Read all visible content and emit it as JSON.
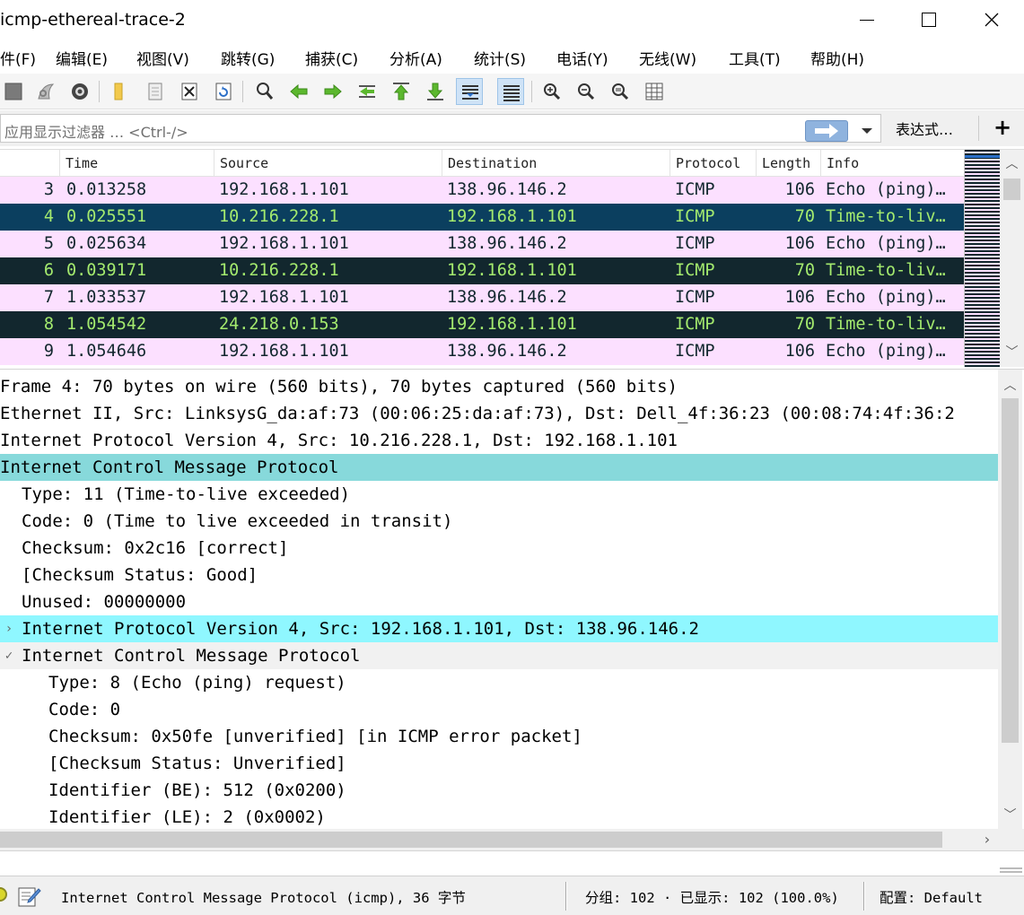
{
  "window": {
    "title": "icmp-ethereal-trace-2"
  },
  "menu": [
    {
      "label": "件(F)"
    },
    {
      "label": "编辑(E)"
    },
    {
      "label": "视图(V)"
    },
    {
      "label": "跳转(G)"
    },
    {
      "label": "捕获(C)"
    },
    {
      "label": "分析(A)"
    },
    {
      "label": "统计(S)"
    },
    {
      "label": "电话(Y)"
    },
    {
      "label": "无线(W)"
    },
    {
      "label": "工具(T)"
    },
    {
      "label": "帮助(H)"
    }
  ],
  "filter": {
    "placeholder": "应用显示过滤器 … <Ctrl-/>",
    "expression_label": "表达式…",
    "plus_label": "+"
  },
  "packet_list": {
    "columns": [
      "Time",
      "Source",
      "Destination",
      "Protocol",
      "Length",
      "Info"
    ],
    "rows": [
      {
        "no": "3",
        "time": "0.013258",
        "source": "192.168.1.101",
        "destination": "138.96.146.2",
        "protocol": "ICMP",
        "length": "106",
        "info": "Echo (ping)…",
        "style": "echo"
      },
      {
        "no": "4",
        "time": "0.025551",
        "source": "10.216.228.1",
        "destination": "192.168.1.101",
        "protocol": "ICMP",
        "length": "70",
        "info": "Time-to-liv…",
        "style": "selected"
      },
      {
        "no": "5",
        "time": "0.025634",
        "source": "192.168.1.101",
        "destination": "138.96.146.2",
        "protocol": "ICMP",
        "length": "106",
        "info": "Echo (ping)…",
        "style": "echo"
      },
      {
        "no": "6",
        "time": "0.039171",
        "source": "10.216.228.1",
        "destination": "192.168.1.101",
        "protocol": "ICMP",
        "length": "70",
        "info": "Time-to-liv…",
        "style": "ttl"
      },
      {
        "no": "7",
        "time": "1.033537",
        "source": "192.168.1.101",
        "destination": "138.96.146.2",
        "protocol": "ICMP",
        "length": "106",
        "info": "Echo (ping)…",
        "style": "echo"
      },
      {
        "no": "8",
        "time": "1.054542",
        "source": "24.218.0.153",
        "destination": "192.168.1.101",
        "protocol": "ICMP",
        "length": "70",
        "info": "Time-to-liv…",
        "style": "ttl"
      },
      {
        "no": "9",
        "time": "1.054646",
        "source": "192.168.1.101",
        "destination": "138.96.146.2",
        "protocol": "ICMP",
        "length": "106",
        "info": "Echo (ping)…",
        "style": "echo"
      }
    ]
  },
  "details": {
    "rows": [
      {
        "text": "Frame 4: 70 bytes on wire (560 bits), 70 bytes captured (560 bits)",
        "indent": 0,
        "style": ""
      },
      {
        "text": "Ethernet II, Src: LinksysG_da:af:73 (00:06:25:da:af:73), Dst: Dell_4f:36:23 (00:08:74:4f:36:2",
        "indent": 0,
        "style": ""
      },
      {
        "text": "Internet Protocol Version 4, Src: 10.216.228.1, Dst: 192.168.1.101",
        "indent": 0,
        "style": ""
      },
      {
        "text": "Internet Control Message Protocol",
        "indent": 0,
        "style": "sel"
      },
      {
        "text": "Type: 11 (Time-to-live exceeded)",
        "indent": 1,
        "style": ""
      },
      {
        "text": "Code: 0 (Time to live exceeded in transit)",
        "indent": 1,
        "style": ""
      },
      {
        "text": "Checksum: 0x2c16 [correct]",
        "indent": 1,
        "style": ""
      },
      {
        "text": "[Checksum Status: Good]",
        "indent": 1,
        "style": ""
      },
      {
        "text": "Unused: 00000000",
        "indent": 1,
        "style": ""
      },
      {
        "text": "Internet Protocol Version 4, Src: 192.168.1.101, Dst: 138.96.146.2",
        "indent": 1,
        "style": "hl",
        "expander": "›"
      },
      {
        "text": "Internet Control Message Protocol",
        "indent": 1,
        "style": "group",
        "expander": "✓"
      },
      {
        "text": "Type: 8 (Echo (ping) request)",
        "indent": 2,
        "style": ""
      },
      {
        "text": "Code: 0",
        "indent": 2,
        "style": ""
      },
      {
        "text": "Checksum: 0x50fe [unverified] [in ICMP error packet]",
        "indent": 2,
        "style": ""
      },
      {
        "text": "[Checksum Status: Unverified]",
        "indent": 2,
        "style": ""
      },
      {
        "text": "Identifier (BE): 512 (0x0200)",
        "indent": 2,
        "style": ""
      },
      {
        "text": "Identifier (LE): 2 (0x0002)",
        "indent": 2,
        "style": ""
      }
    ]
  },
  "status": {
    "field_text": "Internet Control Message Protocol (icmp), 36 字节",
    "counts": "分组: 102 · 已显示: 102 (100.0%)",
    "profile": "配置: Default"
  },
  "colors": {
    "echo_bg": "#fce0ff",
    "ttl_bg": "#12272e",
    "ttl_fg": "#a4ea6e",
    "selected_row_bg": "#0b3f5f",
    "detail_selected_bg": "#87d9db",
    "detail_highlight_bg": "#8ff7ff"
  }
}
